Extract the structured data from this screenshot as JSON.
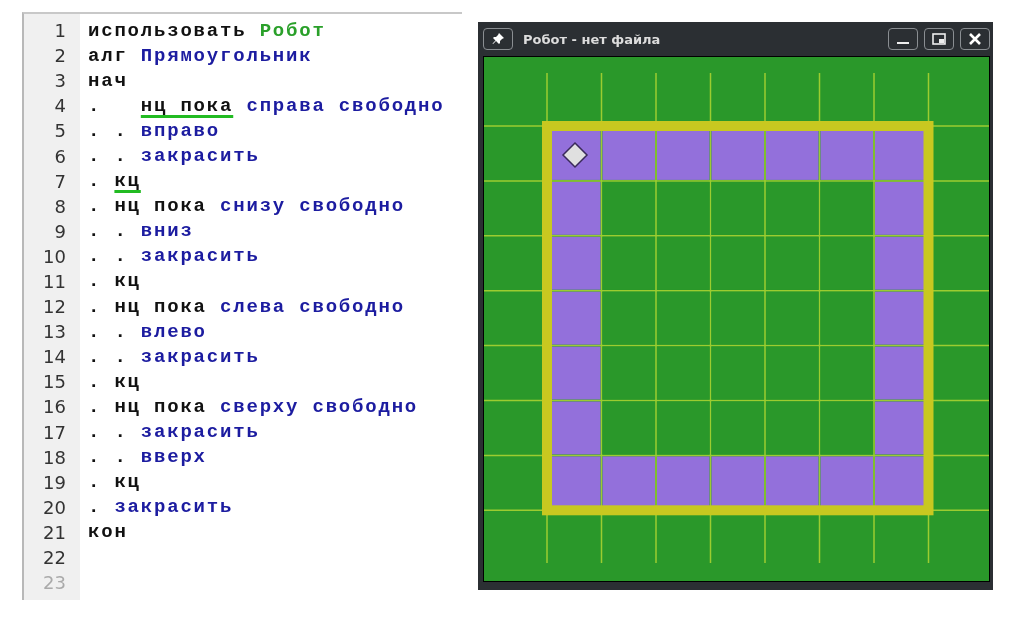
{
  "editor": {
    "lines": [
      {
        "number": "1",
        "dim": false,
        "tokens": [
          {
            "text": "использовать",
            "kind": "keyword",
            "underlined": false
          },
          {
            "text": "Робот",
            "kind": "module",
            "underlined": false
          }
        ]
      },
      {
        "number": "2",
        "dim": false,
        "tokens": [
          {
            "text": "алг",
            "kind": "keyword",
            "underlined": false
          },
          {
            "text": "Прямоугольник",
            "kind": "command",
            "underlined": false
          }
        ]
      },
      {
        "number": "3",
        "dim": false,
        "tokens": [
          {
            "text": "нач",
            "kind": "keyword",
            "underlined": false
          }
        ]
      },
      {
        "number": "4",
        "dim": false,
        "tokens": [
          {
            "text": ".  ",
            "kind": "dots",
            "underlined": false
          },
          {
            "text": "нц пока",
            "kind": "keyword",
            "underlined": true
          },
          {
            "text": "справа свободно",
            "kind": "command",
            "underlined": false
          }
        ]
      },
      {
        "number": "5",
        "dim": false,
        "tokens": [
          {
            "text": ". .",
            "kind": "dots",
            "underlined": false
          },
          {
            "text": "вправо",
            "kind": "command",
            "underlined": false
          }
        ]
      },
      {
        "number": "6",
        "dim": false,
        "tokens": [
          {
            "text": ". .",
            "kind": "dots",
            "underlined": false
          },
          {
            "text": "закрасить",
            "kind": "command",
            "underlined": false
          }
        ]
      },
      {
        "number": "7",
        "dim": false,
        "tokens": [
          {
            "text": ".",
            "kind": "dots",
            "underlined": false
          },
          {
            "text": "кц",
            "kind": "keyword",
            "underlined": true
          }
        ]
      },
      {
        "number": "8",
        "dim": false,
        "tokens": [
          {
            "text": ".",
            "kind": "dots",
            "underlined": false
          },
          {
            "text": "нц пока",
            "kind": "keyword",
            "underlined": false
          },
          {
            "text": "снизу свободно",
            "kind": "command",
            "underlined": false
          }
        ]
      },
      {
        "number": "9",
        "dim": false,
        "tokens": [
          {
            "text": ". .",
            "kind": "dots",
            "underlined": false
          },
          {
            "text": "вниз",
            "kind": "command",
            "underlined": false
          }
        ]
      },
      {
        "number": "10",
        "dim": false,
        "tokens": [
          {
            "text": ". .",
            "kind": "dots",
            "underlined": false
          },
          {
            "text": "закрасить",
            "kind": "command",
            "underlined": false
          }
        ]
      },
      {
        "number": "11",
        "dim": false,
        "tokens": [
          {
            "text": ".",
            "kind": "dots",
            "underlined": false
          },
          {
            "text": "кц",
            "kind": "keyword",
            "underlined": false
          }
        ]
      },
      {
        "number": "12",
        "dim": false,
        "tokens": [
          {
            "text": ".",
            "kind": "dots",
            "underlined": false
          },
          {
            "text": "нц пока",
            "kind": "keyword",
            "underlined": false
          },
          {
            "text": "слева свободно",
            "kind": "command",
            "underlined": false
          }
        ]
      },
      {
        "number": "13",
        "dim": false,
        "tokens": [
          {
            "text": ". .",
            "kind": "dots",
            "underlined": false
          },
          {
            "text": "влево",
            "kind": "command",
            "underlined": false
          }
        ]
      },
      {
        "number": "14",
        "dim": false,
        "tokens": [
          {
            "text": ". .",
            "kind": "dots",
            "underlined": false
          },
          {
            "text": "закрасить",
            "kind": "command",
            "underlined": false
          }
        ]
      },
      {
        "number": "15",
        "dim": false,
        "tokens": [
          {
            "text": ".",
            "kind": "dots",
            "underlined": false
          },
          {
            "text": "кц",
            "kind": "keyword",
            "underlined": false
          }
        ]
      },
      {
        "number": "16",
        "dim": false,
        "tokens": [
          {
            "text": ".",
            "kind": "dots",
            "underlined": false
          },
          {
            "text": "нц пока",
            "kind": "keyword",
            "underlined": false
          },
          {
            "text": "сверху свободно",
            "kind": "command",
            "underlined": false
          }
        ]
      },
      {
        "number": "17",
        "dim": false,
        "tokens": [
          {
            "text": ". .",
            "kind": "dots",
            "underlined": false
          },
          {
            "text": "закрасить",
            "kind": "command",
            "underlined": false
          }
        ]
      },
      {
        "number": "18",
        "dim": false,
        "tokens": [
          {
            "text": ". .",
            "kind": "dots",
            "underlined": false
          },
          {
            "text": "вверх",
            "kind": "command",
            "underlined": false
          }
        ]
      },
      {
        "number": "19",
        "dim": false,
        "tokens": [
          {
            "text": ".",
            "kind": "dots",
            "underlined": false
          },
          {
            "text": "кц",
            "kind": "keyword",
            "underlined": false
          }
        ]
      },
      {
        "number": "20",
        "dim": false,
        "tokens": [
          {
            "text": ".",
            "kind": "dots",
            "underlined": false
          },
          {
            "text": "закрасить",
            "kind": "command",
            "underlined": false
          }
        ]
      },
      {
        "number": "21",
        "dim": false,
        "tokens": [
          {
            "text": "кон",
            "kind": "keyword",
            "underlined": false
          }
        ]
      },
      {
        "number": "22",
        "dim": false
      },
      {
        "number": "23",
        "dim": true
      }
    ]
  },
  "robot_window": {
    "title": "Робот - нет файла",
    "field": {
      "rows": [
        {
          "cells": [
            {
              "painted": true,
              "robot": true
            },
            {
              "painted": true,
              "robot": false
            },
            {
              "painted": true,
              "robot": false
            },
            {
              "painted": true,
              "robot": false
            },
            {
              "painted": true,
              "robot": false
            },
            {
              "painted": true,
              "robot": false
            },
            {
              "painted": true,
              "robot": false
            }
          ]
        },
        {
          "cells": [
            {
              "painted": true,
              "robot": false
            },
            {
              "painted": false,
              "robot": false
            },
            {
              "painted": false,
              "robot": false
            },
            {
              "painted": false,
              "robot": false
            },
            {
              "painted": false,
              "robot": false
            },
            {
              "painted": false,
              "robot": false
            },
            {
              "painted": true,
              "robot": false
            }
          ]
        },
        {
          "cells": [
            {
              "painted": true,
              "robot": false
            },
            {
              "painted": false,
              "robot": false
            },
            {
              "painted": false,
              "robot": false
            },
            {
              "painted": false,
              "robot": false
            },
            {
              "painted": false,
              "robot": false
            },
            {
              "painted": false,
              "robot": false
            },
            {
              "painted": true,
              "robot": false
            }
          ]
        },
        {
          "cells": [
            {
              "painted": true,
              "robot": false
            },
            {
              "painted": false,
              "robot": false
            },
            {
              "painted": false,
              "robot": false
            },
            {
              "painted": false,
              "robot": false
            },
            {
              "painted": false,
              "robot": false
            },
            {
              "painted": false,
              "robot": false
            },
            {
              "painted": true,
              "robot": false
            }
          ]
        },
        {
          "cells": [
            {
              "painted": true,
              "robot": false
            },
            {
              "painted": false,
              "robot": false
            },
            {
              "painted": false,
              "robot": false
            },
            {
              "painted": false,
              "robot": false
            },
            {
              "painted": false,
              "robot": false
            },
            {
              "painted": false,
              "robot": false
            },
            {
              "painted": true,
              "robot": false
            }
          ]
        },
        {
          "cells": [
            {
              "painted": true,
              "robot": false
            },
            {
              "painted": false,
              "robot": false
            },
            {
              "painted": false,
              "robot": false
            },
            {
              "painted": false,
              "robot": false
            },
            {
              "painted": false,
              "robot": false
            },
            {
              "painted": false,
              "robot": false
            },
            {
              "painted": true,
              "robot": false
            }
          ]
        },
        {
          "cells": [
            {
              "painted": true,
              "robot": false
            },
            {
              "painted": true,
              "robot": false
            },
            {
              "painted": true,
              "robot": false
            },
            {
              "painted": true,
              "robot": false
            },
            {
              "painted": true,
              "robot": false
            },
            {
              "painted": true,
              "robot": false
            },
            {
              "painted": true,
              "robot": false
            }
          ]
        }
      ]
    }
  }
}
